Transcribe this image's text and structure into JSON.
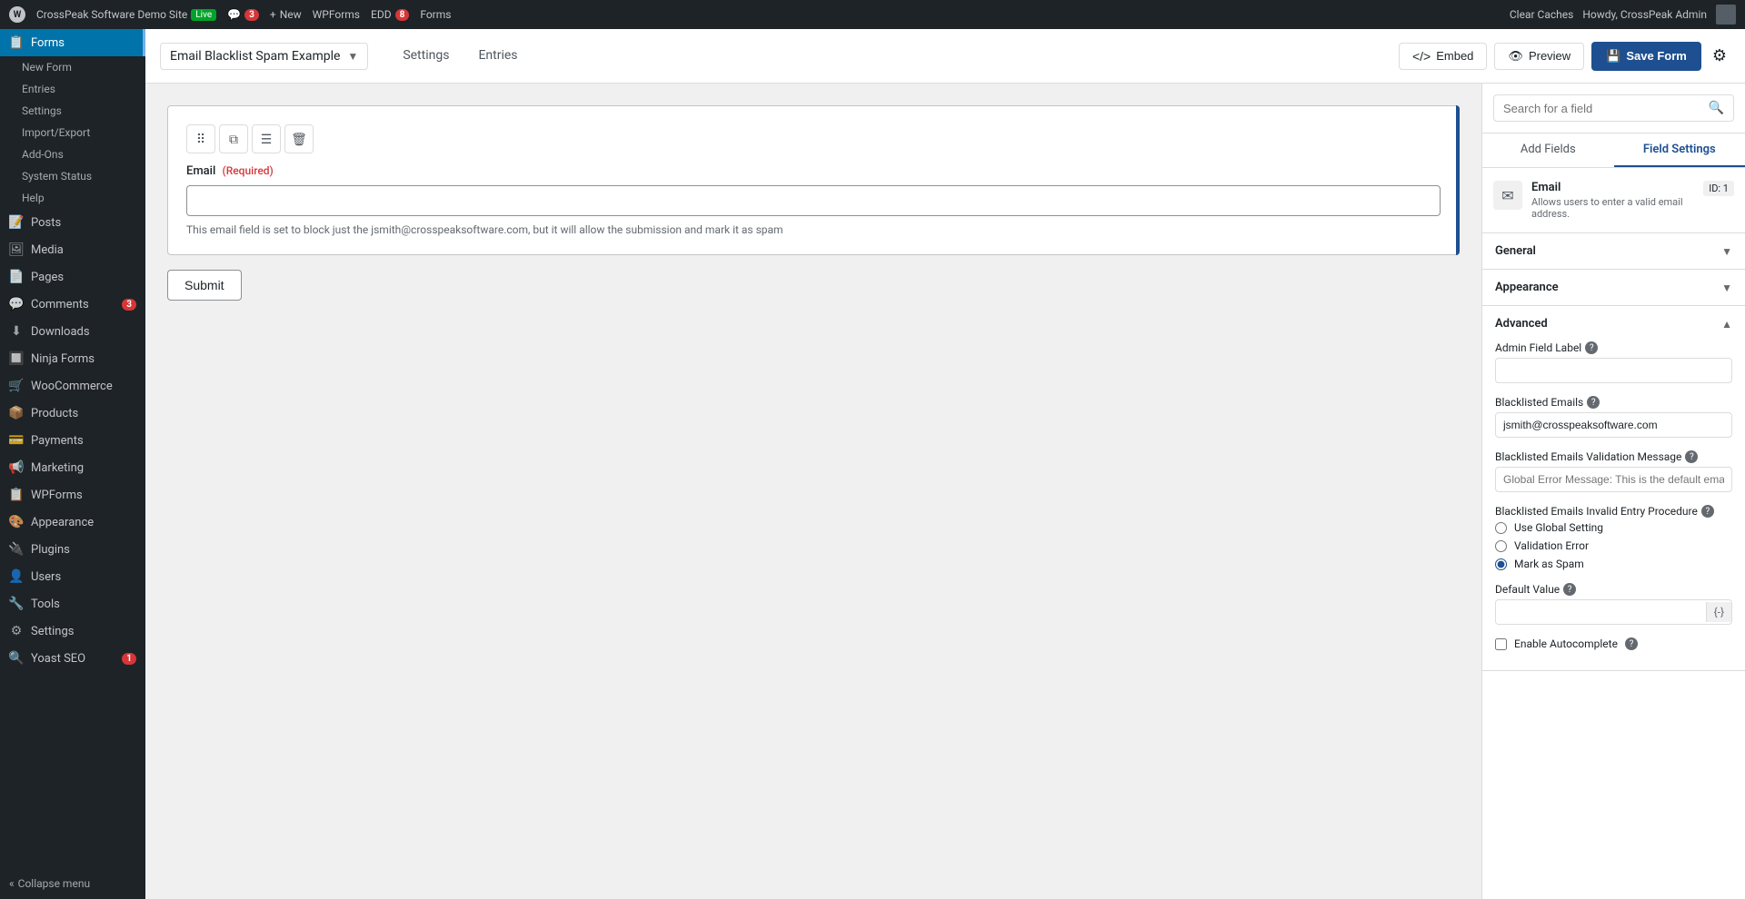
{
  "adminbar": {
    "site_name": "CrossPeak Software Demo Site",
    "live_label": "Live",
    "comments_count": "3",
    "new_label": "New",
    "wpforms_label": "WPForms",
    "edd_label": "EDD",
    "edd_count": "8",
    "forms_label": "Forms",
    "clear_caches": "Clear Caches",
    "howdy": "Howdy, CrossPeak Admin"
  },
  "sidebar": {
    "items": [
      {
        "id": "posts",
        "label": "Posts",
        "icon": "📝"
      },
      {
        "id": "media",
        "label": "Media",
        "icon": "🖼"
      },
      {
        "id": "forms",
        "label": "Forms",
        "icon": "📋",
        "active": true
      },
      {
        "id": "pages",
        "label": "Pages",
        "icon": "📄"
      },
      {
        "id": "comments",
        "label": "Comments",
        "icon": "💬",
        "badge": "3"
      },
      {
        "id": "downloads",
        "label": "Downloads",
        "icon": "⬇"
      },
      {
        "id": "ninja-forms",
        "label": "Ninja Forms",
        "icon": "📋"
      },
      {
        "id": "woocommerce",
        "label": "WooCommerce",
        "icon": "🛒"
      },
      {
        "id": "products",
        "label": "Products",
        "icon": "📦"
      },
      {
        "id": "payments",
        "label": "Payments",
        "icon": "💳"
      },
      {
        "id": "marketing",
        "label": "Marketing",
        "icon": "📢"
      },
      {
        "id": "wpforms",
        "label": "WPForms",
        "icon": "📋"
      },
      {
        "id": "appearance",
        "label": "Appearance",
        "icon": "🎨"
      },
      {
        "id": "plugins",
        "label": "Plugins",
        "icon": "🔌"
      },
      {
        "id": "users",
        "label": "Users",
        "icon": "👤"
      },
      {
        "id": "tools",
        "label": "Tools",
        "icon": "🔧"
      },
      {
        "id": "settings",
        "label": "Settings",
        "icon": "⚙"
      },
      {
        "id": "yoast",
        "label": "Yoast SEO",
        "icon": "🔍",
        "badge": "1"
      }
    ],
    "sub_items": [
      {
        "id": "new-form",
        "label": "New Form"
      },
      {
        "id": "entries",
        "label": "Entries"
      },
      {
        "id": "settings-sub",
        "label": "Settings"
      },
      {
        "id": "import-export",
        "label": "Import/Export"
      },
      {
        "id": "add-ons",
        "label": "Add-Ons"
      },
      {
        "id": "system-status",
        "label": "System Status"
      },
      {
        "id": "help",
        "label": "Help"
      }
    ],
    "collapse": "Collapse menu"
  },
  "header": {
    "form_title": "Email Blacklist Spam Example",
    "tabs": [
      {
        "id": "settings",
        "label": "Settings"
      },
      {
        "id": "entries",
        "label": "Entries"
      }
    ],
    "embed_label": "Embed",
    "preview_label": "Preview",
    "save_label": "Save Form"
  },
  "canvas": {
    "field": {
      "label": "Email",
      "required_label": "(Required)",
      "description": "This email field is set to block just the jsmith@crosspeaksoftware.com, but it will allow the submission and mark it as spam",
      "placeholder": ""
    },
    "submit_label": "Submit"
  },
  "right_panel": {
    "search_placeholder": "Search for a field",
    "tabs": [
      {
        "id": "add-fields",
        "label": "Add Fields"
      },
      {
        "id": "field-settings",
        "label": "Field Settings",
        "active": true
      }
    ],
    "field_info": {
      "title": "Email",
      "description": "Allows users to enter a valid email address.",
      "id_label": "ID: 1"
    },
    "sections": [
      {
        "id": "general",
        "label": "General",
        "expanded": false
      },
      {
        "id": "appearance",
        "label": "Appearance",
        "expanded": false
      },
      {
        "id": "advanced",
        "label": "Advanced",
        "expanded": true
      }
    ],
    "advanced": {
      "admin_field_label": "Admin Field Label",
      "admin_field_value": "",
      "blacklisted_emails_label": "Blacklisted Emails",
      "blacklisted_emails_value": "jsmith@crosspeaksoftware.com",
      "blacklisted_validation_label": "Blacklisted Emails Validation Message",
      "blacklisted_validation_placeholder": "Global Error Message: This is the default email blac",
      "invalid_entry_label": "Blacklisted Emails Invalid Entry Procedure",
      "radio_options": [
        {
          "id": "use-global",
          "label": "Use Global Setting",
          "checked": false
        },
        {
          "id": "validation-error",
          "label": "Validation Error",
          "checked": false
        },
        {
          "id": "mark-spam",
          "label": "Mark as Spam",
          "checked": true
        }
      ],
      "default_value_label": "Default Value",
      "default_value": "",
      "default_value_suffix": "{-}",
      "enable_autocomplete_label": "Enable Autocomplete",
      "enable_autocomplete_checked": false
    }
  }
}
